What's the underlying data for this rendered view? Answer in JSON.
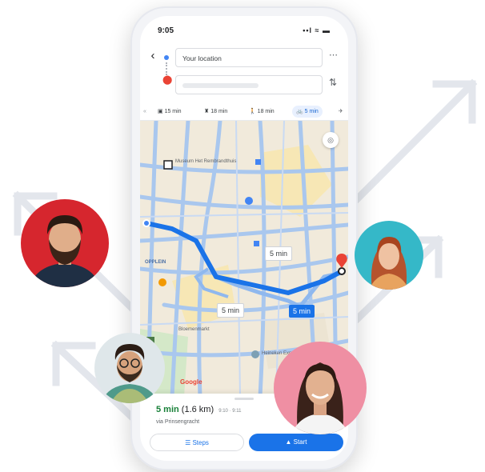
{
  "status_bar": {
    "time": "9:05",
    "signal": "••l ≈ ▬"
  },
  "directions": {
    "origin": "Your location",
    "destination": "",
    "modes": [
      {
        "icon": "car-icon",
        "label": "15 min",
        "active": false
      },
      {
        "icon": "transit-icon",
        "label": "18 min",
        "active": false
      },
      {
        "icon": "walk-icon",
        "label": "18 min",
        "active": false
      },
      {
        "icon": "bike-icon",
        "label": "5 min",
        "active": true
      }
    ]
  },
  "map": {
    "route_labels": {
      "alt_upper": "5 min",
      "alt_lower": "5 min",
      "primary": "5 min"
    },
    "place_labels": [
      "Museum Het Rembrandthuis",
      "OPPLEIN",
      "Bloemenmarkt",
      "Heineken Experience"
    ],
    "google_mark": "Google"
  },
  "bottom_sheet": {
    "eta": "5 min",
    "distance": "(1.6 km)",
    "detail": "9:10 · 9:11",
    "via": "via Prinsengracht",
    "steps_label": "Steps",
    "start_label": "Start"
  },
  "colors": {
    "route_primary": "#1a73e8",
    "route_alt": "#8fb8ee",
    "accent_green": "#188038",
    "pin": "#ea4335"
  },
  "avatars": [
    {
      "name": "bearded-man",
      "background": "#d6262e"
    },
    {
      "name": "curly-man",
      "background": "#dfe7ea"
    },
    {
      "name": "redhead-woman",
      "background": "#35b8c8"
    },
    {
      "name": "smiling-woman",
      "background": "#ef8fa3"
    }
  ]
}
